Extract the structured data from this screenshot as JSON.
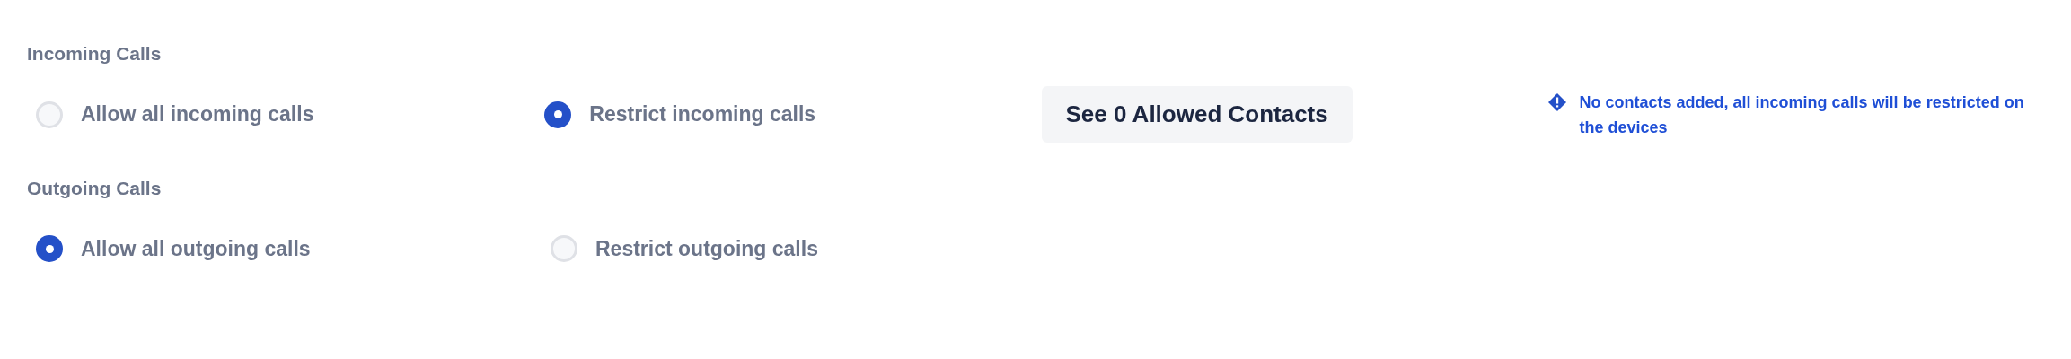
{
  "sections": [
    {
      "title": "Incoming Calls",
      "options": [
        {
          "label": "Allow all incoming calls",
          "selected": false
        },
        {
          "label": "Restrict incoming calls",
          "selected": true
        }
      ],
      "button": "See 0 Allowed Contacts",
      "notice": "No contacts added, all incoming calls will be restricted on the devices"
    },
    {
      "title": "Outgoing Calls",
      "options": [
        {
          "label": "Allow all outgoing calls",
          "selected": true
        },
        {
          "label": "Restrict outgoing calls",
          "selected": false
        }
      ]
    }
  ]
}
